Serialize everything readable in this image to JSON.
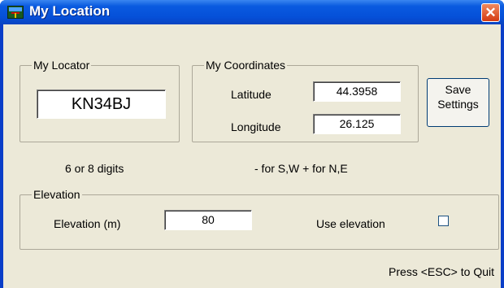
{
  "window": {
    "title": "My Location",
    "close_glyph": "✕"
  },
  "locator": {
    "group_label": "My Locator",
    "value": "KN34BJ",
    "hint": "6 or 8 digits"
  },
  "coordinates": {
    "group_label": "My Coordinates",
    "latitude_label": "Latitude",
    "latitude_value": "44.3958",
    "longitude_label": "Longitude",
    "longitude_value": "26.125",
    "hint": "- for S,W + for N,E"
  },
  "save_button": {
    "line1": "Save",
    "line2": "Settings"
  },
  "elevation": {
    "group_label": "Elevation",
    "elevation_label": "Elevation (m)",
    "value": "80",
    "use_label": "Use elevation",
    "use_checked": false
  },
  "footer": {
    "quit_hint": "Press <ESC> to Quit"
  },
  "colors": {
    "titlebar": "#0a5ae0",
    "client_bg": "#ece9d8",
    "close_button": "#d43a10"
  },
  "icons": {
    "app": "location-app-icon",
    "close": "close-icon"
  }
}
